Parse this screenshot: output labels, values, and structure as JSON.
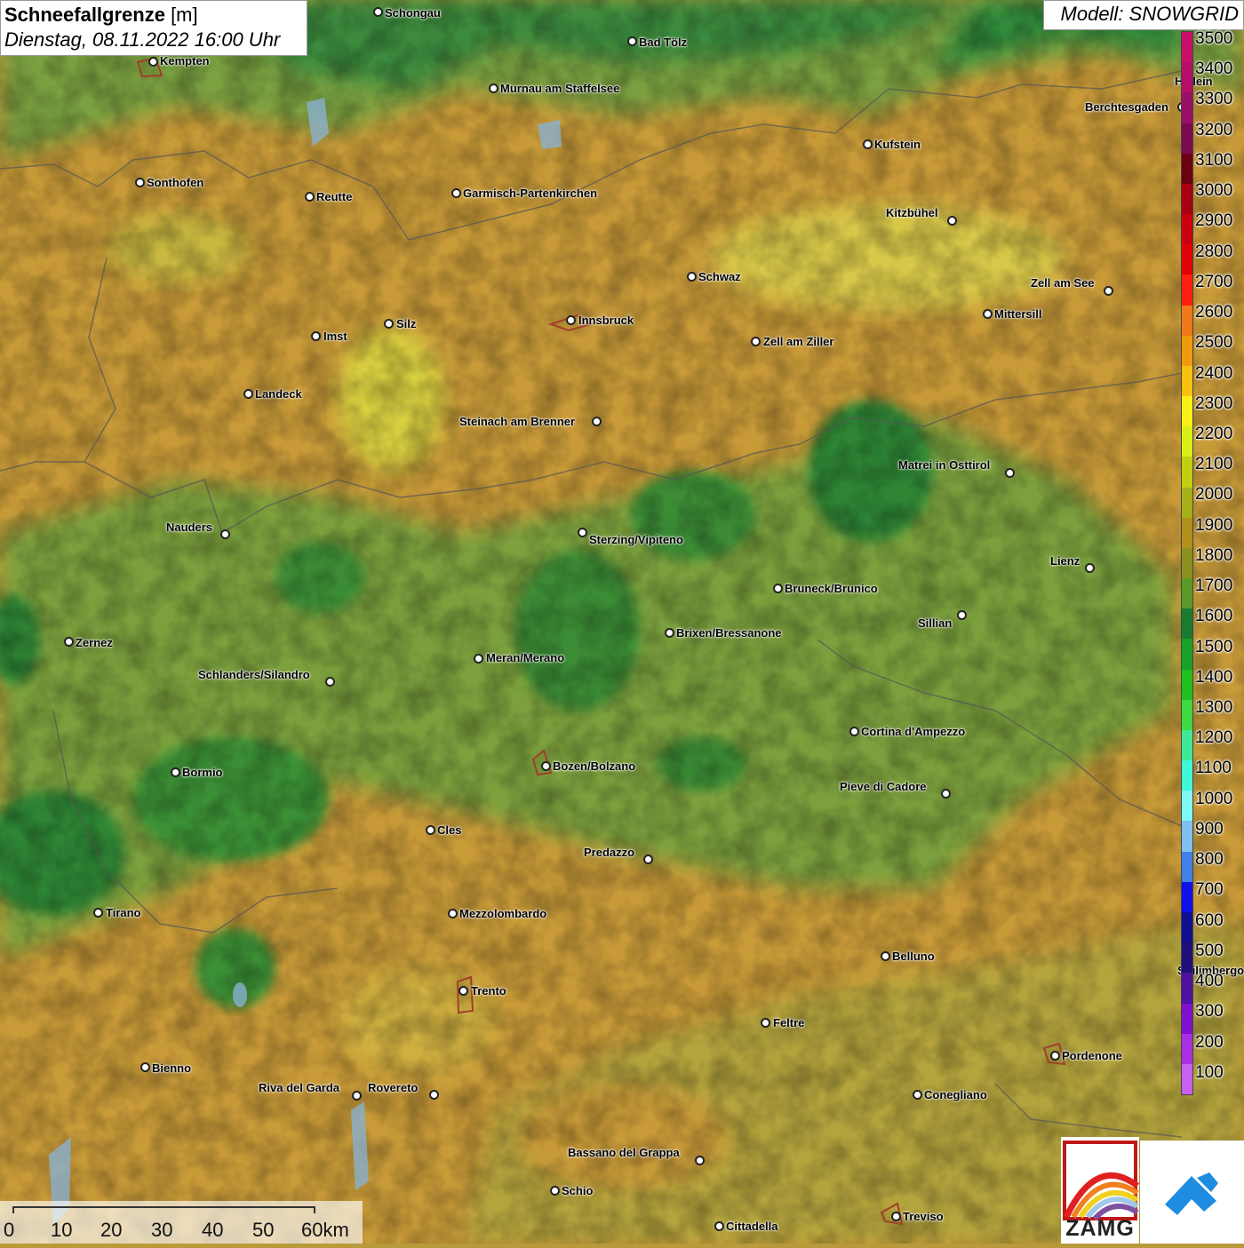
{
  "header": {
    "title_bold": "Schneefallgrenze",
    "title_unit": " [m]",
    "datetime": "Dienstag, 08.11.2022 16:00 Uhr",
    "model": "Modell: SNOWGRID"
  },
  "legend": {
    "levels": [
      "3500",
      "3400",
      "3300",
      "3200",
      "3100",
      "3000",
      "2900",
      "2800",
      "2700",
      "2600",
      "2500",
      "2400",
      "2300",
      "2200",
      "2100",
      "2000",
      "1900",
      "1800",
      "1700",
      "1600",
      "1500",
      "1400",
      "1300",
      "1200",
      "1100",
      "1000",
      "900",
      "800",
      "700",
      "600",
      "500",
      "400",
      "300",
      "200",
      "100"
    ],
    "colors": [
      "#c8106a",
      "#b4106a",
      "#9a1068",
      "#7a0a50",
      "#6a0010",
      "#a80010",
      "#c80010",
      "#e00008",
      "#ff2010",
      "#f07818",
      "#f09a10",
      "#f8c010",
      "#f8f018",
      "#d8f018",
      "#c0d010",
      "#a8b018",
      "#b09018",
      "#8c9020",
      "#5a9a28",
      "#1a7a30",
      "#18a028",
      "#20c020",
      "#40d840",
      "#40e898",
      "#40f8d8",
      "#80f8f8",
      "#80c0f0",
      "#4080e8",
      "#1010e8",
      "#101090",
      "#20107a",
      "#5010a0",
      "#8010d0",
      "#a830e0",
      "#c860f0"
    ]
  },
  "cities": [
    {
      "name": "Schongau"
    },
    {
      "name": "Bad Tölz"
    },
    {
      "name": "Kempten"
    },
    {
      "name": "Murnau am Staffelsee"
    },
    {
      "name": "Berchtesgaden"
    },
    {
      "name": "Kufstein"
    },
    {
      "name": "Sonthofen"
    },
    {
      "name": "Reutte"
    },
    {
      "name": "Garmisch-Partenkirchen"
    },
    {
      "name": "Kitzbühel"
    },
    {
      "name": "Schwaz"
    },
    {
      "name": "Zell am See"
    },
    {
      "name": "Innsbruck"
    },
    {
      "name": "Mittersill"
    },
    {
      "name": "Silz"
    },
    {
      "name": "Imst"
    },
    {
      "name": "Zell am Ziller"
    },
    {
      "name": "Landeck"
    },
    {
      "name": "Steinach am Brenner"
    },
    {
      "name": "Matrei in Osttirol"
    },
    {
      "name": "Nauders"
    },
    {
      "name": "Sterzing/Vipiteno"
    },
    {
      "name": "Lienz"
    },
    {
      "name": "Bruneck/Brunico"
    },
    {
      "name": "Sillian"
    },
    {
      "name": "Brixen/Bressanone"
    },
    {
      "name": "Zernez"
    },
    {
      "name": "Meran/Merano"
    },
    {
      "name": "Schlanders/Silandro"
    },
    {
      "name": "Cortina d'Ampezzo"
    },
    {
      "name": "Bozen/Bolzano"
    },
    {
      "name": "Bormio"
    },
    {
      "name": "Pieve di Cadore"
    },
    {
      "name": "Cles"
    },
    {
      "name": "Predazzo"
    },
    {
      "name": "Tirano"
    },
    {
      "name": "Mezzolombardo"
    },
    {
      "name": "Belluno"
    },
    {
      "name": "Trento"
    },
    {
      "name": "Feltre"
    },
    {
      "name": "Pordenone"
    },
    {
      "name": "Bienno"
    },
    {
      "name": "Riva del Garda"
    },
    {
      "name": "Rovereto"
    },
    {
      "name": "Conegliano"
    },
    {
      "name": "Bassano del Grappa"
    },
    {
      "name": "Schio"
    },
    {
      "name": "Treviso"
    },
    {
      "name": "Cittadella"
    }
  ],
  "partial_labels": {
    "hallein": "Hallein",
    "spilimbergo": "Spilimbergo"
  },
  "scalebar": {
    "ticks": [
      "0",
      "10",
      "20",
      "30",
      "40",
      "50",
      "60km"
    ]
  },
  "logos": {
    "zamg": "ZAMG"
  }
}
